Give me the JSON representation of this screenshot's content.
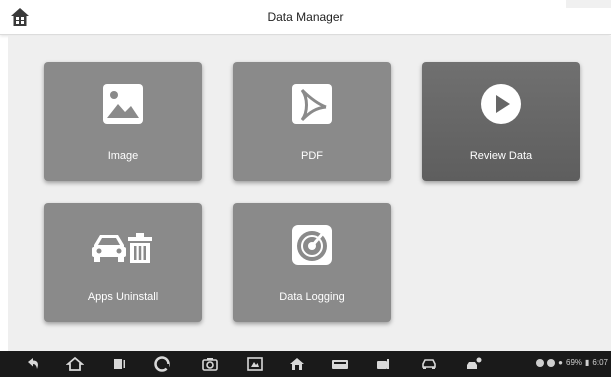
{
  "header": {
    "title": "Data Manager",
    "home_icon": "home-icon"
  },
  "tiles": [
    {
      "label": "Image",
      "icon": "image-icon"
    },
    {
      "label": "PDF",
      "icon": "pdf-icon"
    },
    {
      "label": "Review Data",
      "icon": "play-icon"
    },
    {
      "label": "Apps Uninstall",
      "icon": "car-trash-icon"
    },
    {
      "label": "Data Logging",
      "icon": "datalog-disc-icon"
    }
  ],
  "navbar": {
    "icons": [
      "back-icon",
      "home-icon",
      "recent-apps-icon",
      "browser-icon",
      "camera-icon",
      "screenshot-icon",
      "vehicle-home-icon",
      "vci-icon",
      "diagnostic-icon",
      "car-icon",
      "remote-icon"
    ],
    "status_text": "69%",
    "time": "6:07"
  },
  "colors": {
    "tile": "#8a8a8a",
    "tile_selected": "#666666",
    "background": "#efefef",
    "navbar": "#1a1a1a"
  }
}
